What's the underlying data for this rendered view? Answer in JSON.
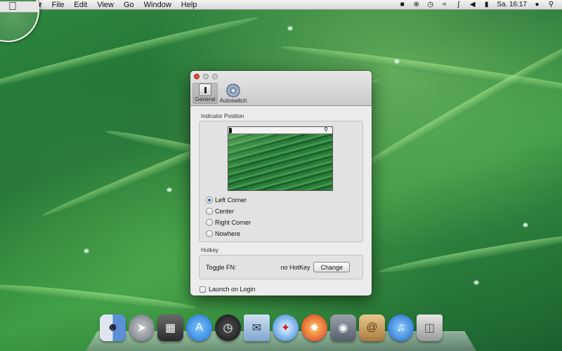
{
  "menubar": {
    "app_name": "Finder",
    "menus": [
      "File",
      "Edit",
      "View",
      "Go",
      "Window",
      "Help"
    ],
    "clock": "Sa. 16:17"
  },
  "window": {
    "tabs": [
      {
        "label": "General",
        "icon": "general-icon",
        "selected": true
      },
      {
        "label": "Autoswitch",
        "icon": "gear-icon",
        "selected": false
      }
    ],
    "indicator_section_label": "Indicator Position",
    "positions": [
      {
        "label": "Left Corner",
        "checked": true
      },
      {
        "label": "Center",
        "checked": false
      },
      {
        "label": "Right Corner",
        "checked": false
      },
      {
        "label": "Nowhere",
        "checked": false
      }
    ],
    "hotkey_section_label": "Hotkey",
    "toggle_label": "Toggle FN:",
    "hotkey_value": "no HotKey",
    "change_button": "Change",
    "launch_label": "Launch on Login",
    "launch_checked": false
  },
  "dock": {
    "icons": [
      "finder-icon",
      "launchpad-icon",
      "mission-control-icon",
      "app-store-icon",
      "dashboard-icon",
      "mail-icon",
      "safari-icon",
      "photo-booth-icon",
      "facetime-icon",
      "contacts-icon",
      "itunes-icon",
      "trash-icon"
    ]
  },
  "colors": {
    "close_light": "#e4473c",
    "radio_accent": "#2a5fb5",
    "wallpaper": "#2f8a3e"
  }
}
